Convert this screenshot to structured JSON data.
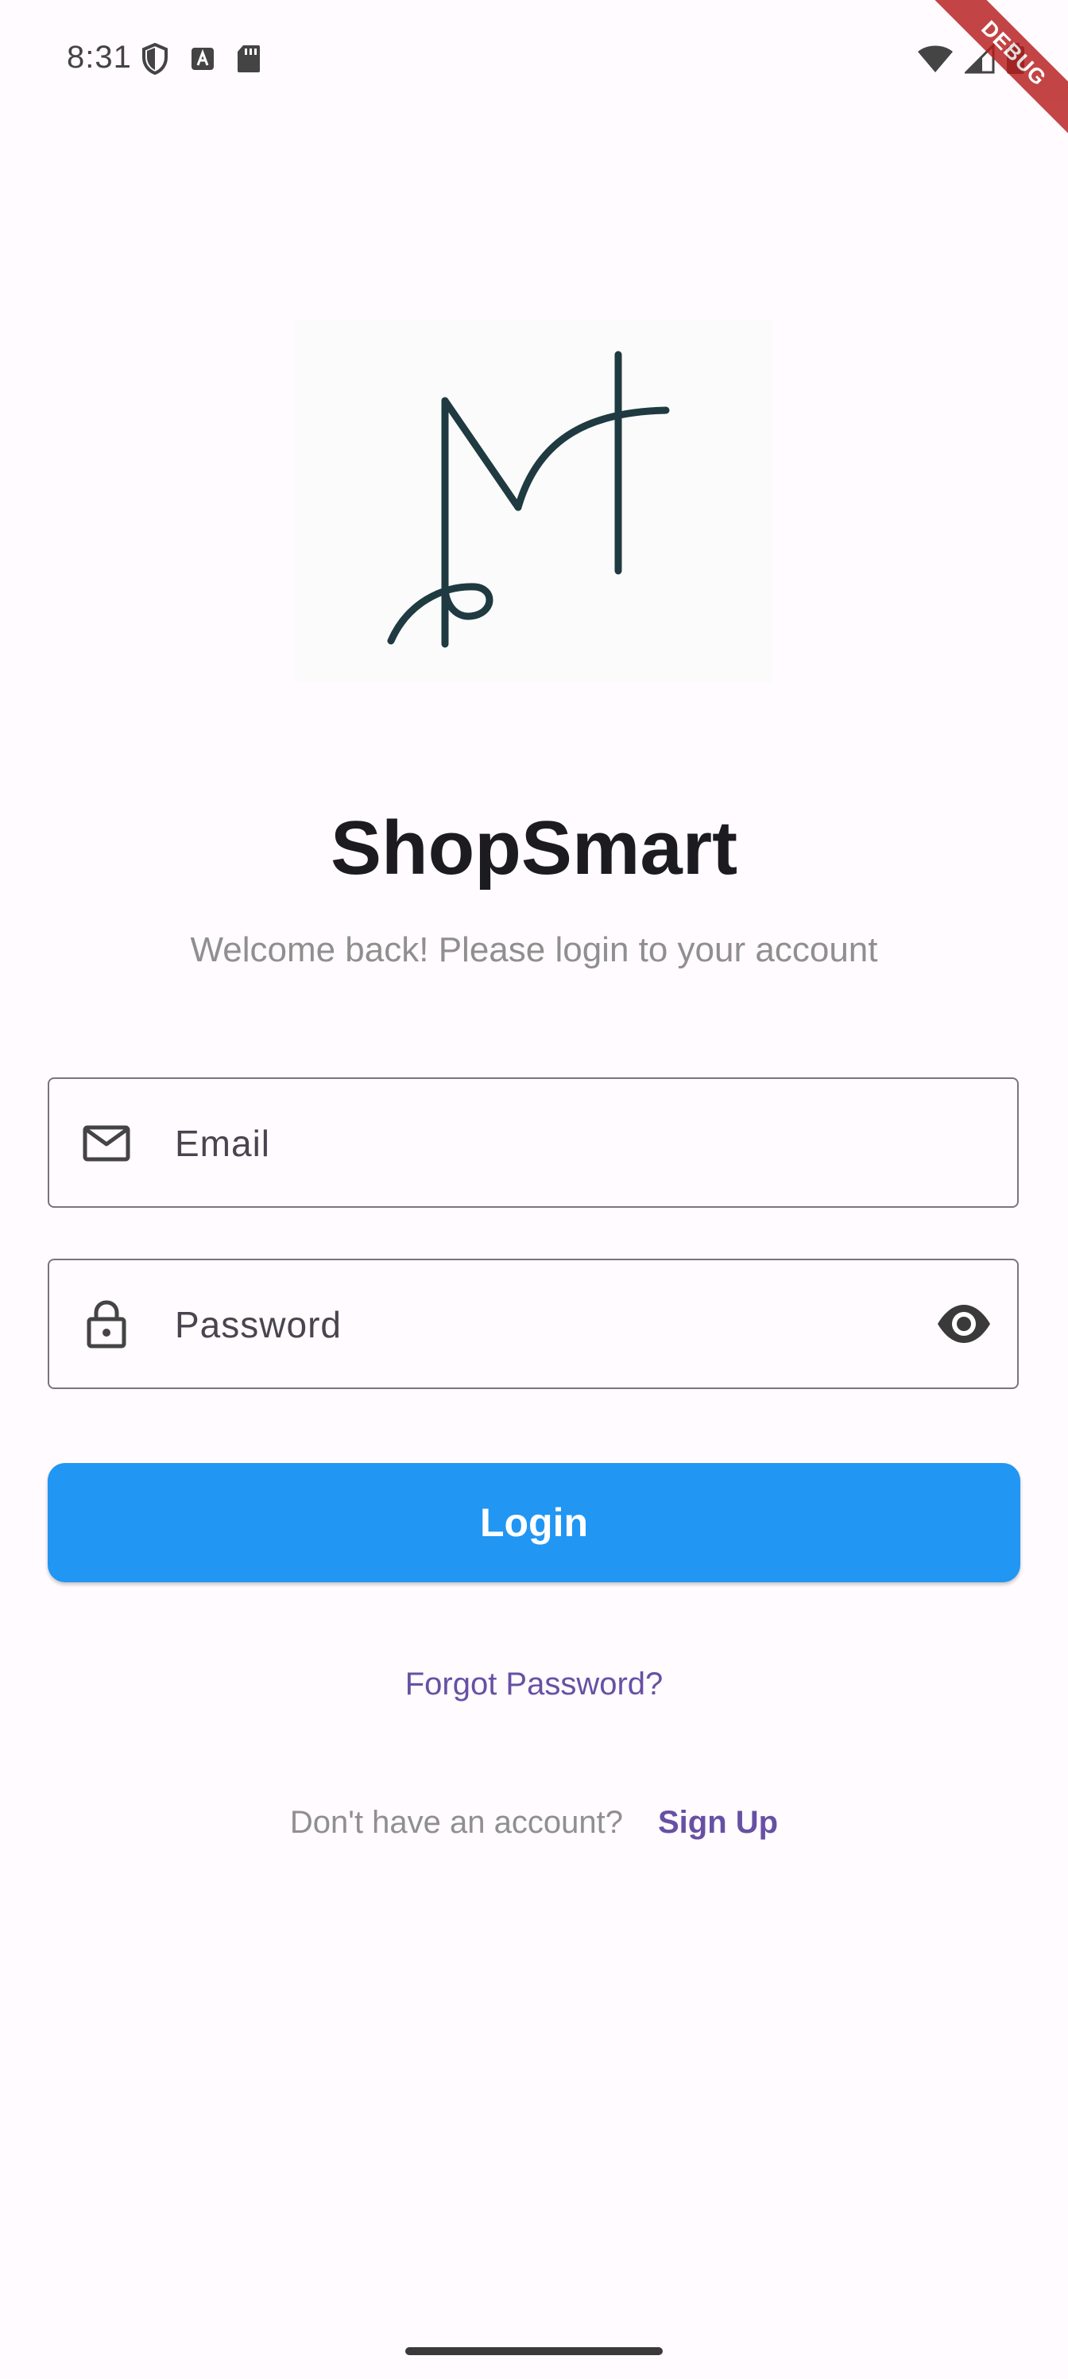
{
  "status_bar": {
    "time": "8:31",
    "left_icons": [
      "shield-icon",
      "text-a-icon",
      "sd-card-icon"
    ],
    "right_icons": [
      "wifi-icon",
      "cellular-icon",
      "battery-icon"
    ]
  },
  "debug_banner": "DEBUG",
  "logo": {
    "icon": "signature-logo",
    "stroke_color": "#1f3a40"
  },
  "app": {
    "title": "ShopSmart",
    "subtitle": "Welcome back! Please login to your account"
  },
  "form": {
    "email": {
      "placeholder": "Email",
      "value": "",
      "icon": "mail-icon"
    },
    "password": {
      "placeholder": "Password",
      "value": "",
      "icon": "lock-icon",
      "toggle_icon": "eye-icon"
    }
  },
  "actions": {
    "login_label": "Login",
    "forgot_password": "Forgot Password?",
    "signup_prompt": "Don't have an account?",
    "signup_label": "Sign Up"
  },
  "colors": {
    "primary": "#2196f3",
    "link": "#6750a4",
    "background": "#fffbfe",
    "muted_text": "#8f8f8f",
    "debug": "#b71c1c"
  }
}
